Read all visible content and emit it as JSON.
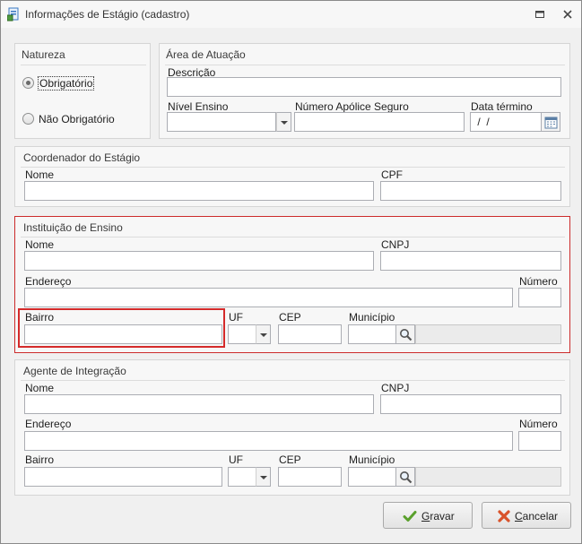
{
  "window": {
    "title": "Informações de Estágio (cadastro)"
  },
  "natureza": {
    "title": "Natureza",
    "options": [
      {
        "label": "Obrigatório",
        "selected": true
      },
      {
        "label": "Não Obrigatório",
        "selected": false
      }
    ]
  },
  "area": {
    "title": "Área de Atuação",
    "descricao_label": "Descrição",
    "descricao_value": "",
    "nivel_label": "Nível Ensino",
    "nivel_value": "",
    "apolice_label": "Número Apólice Seguro",
    "apolice_value": "",
    "data_label": "Data término",
    "data_value": " /  /"
  },
  "coordenador": {
    "title": "Coordenador do Estágio",
    "nome_label": "Nome",
    "cpf_label": "CPF"
  },
  "instituicao": {
    "title": "Instituição de Ensino",
    "nome_label": "Nome",
    "cnpj_label": "CNPJ",
    "endereco_label": "Endereço",
    "numero_label": "Número",
    "bairro_label": "Bairro",
    "uf_label": "UF",
    "cep_label": "CEP",
    "municipio_label": "Município"
  },
  "agente": {
    "title": "Agente de Integração",
    "nome_label": "Nome",
    "cnpj_label": "CNPJ",
    "endereco_label": "Endereço",
    "numero_label": "Número",
    "bairro_label": "Bairro",
    "uf_label": "UF",
    "cep_label": "CEP",
    "municipio_label": "Município"
  },
  "buttons": {
    "gravar_first": "G",
    "gravar_rest": "ravar",
    "cancelar_first": "C",
    "cancelar_rest": "ancelar"
  },
  "colors": {
    "highlight": "#d42a2a",
    "group_border": "#d5d5d5"
  },
  "icons": [
    "app-icon",
    "restore-icon",
    "close-icon",
    "calendar-icon",
    "search-icon",
    "check-icon",
    "x-icon",
    "chevron-down-icon"
  ]
}
